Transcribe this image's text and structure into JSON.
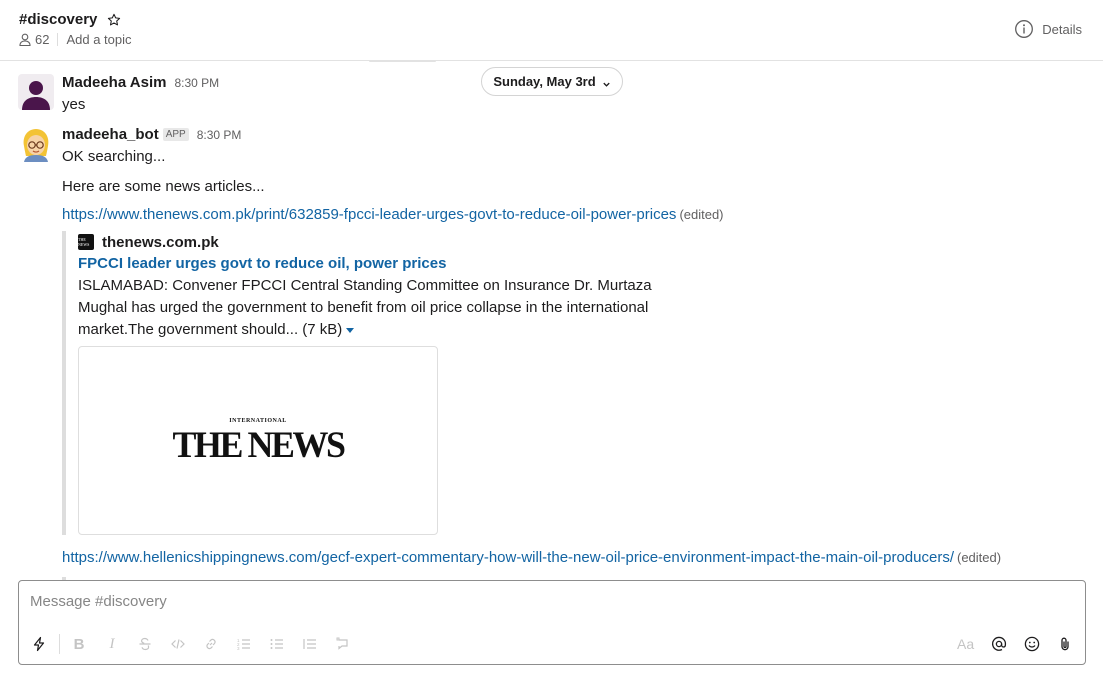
{
  "header": {
    "channel": "#discovery",
    "members": "62",
    "topic": "Add a topic",
    "details_label": "Details"
  },
  "date_divider": {
    "label": "Sunday, May 3rd"
  },
  "messages": [
    {
      "sender": "Madeeha Asim",
      "time": "8:30 PM",
      "text": "yes"
    },
    {
      "sender": "madeeha_bot",
      "badge": "APP",
      "time": "8:30 PM",
      "lines": [
        "OK searching...",
        "Here are some news articles..."
      ],
      "links": [
        {
          "url": "https://www.thenews.com.pk/print/632859-fpcci-leader-urges-govt-to-reduce-oil-power-prices",
          "edited": "(edited)"
        },
        {
          "url": "https://www.hellenicshippingnews.com/gecf-expert-commentary-how-will-the-new-oil-price-environment-impact-the-main-oil-producers/",
          "edited": "(edited)"
        }
      ],
      "unfurl": {
        "site": "thenews.com.pk",
        "title": "FPCCI leader urges govt to reduce oil, power prices",
        "description": "ISLAMABAD: Convener FPCCI Central Standing Committee on Insurance Dr. Murtaza Mughal has urged the government to benefit from oil price collapse in the international market.The government should...",
        "size": "(7 kB)",
        "image_logo_small": "INTERNATIONAL",
        "image_logo_main": "THE NEWS"
      }
    }
  ],
  "composer": {
    "placeholder": "Message #discovery",
    "aa_label": "Aa"
  }
}
